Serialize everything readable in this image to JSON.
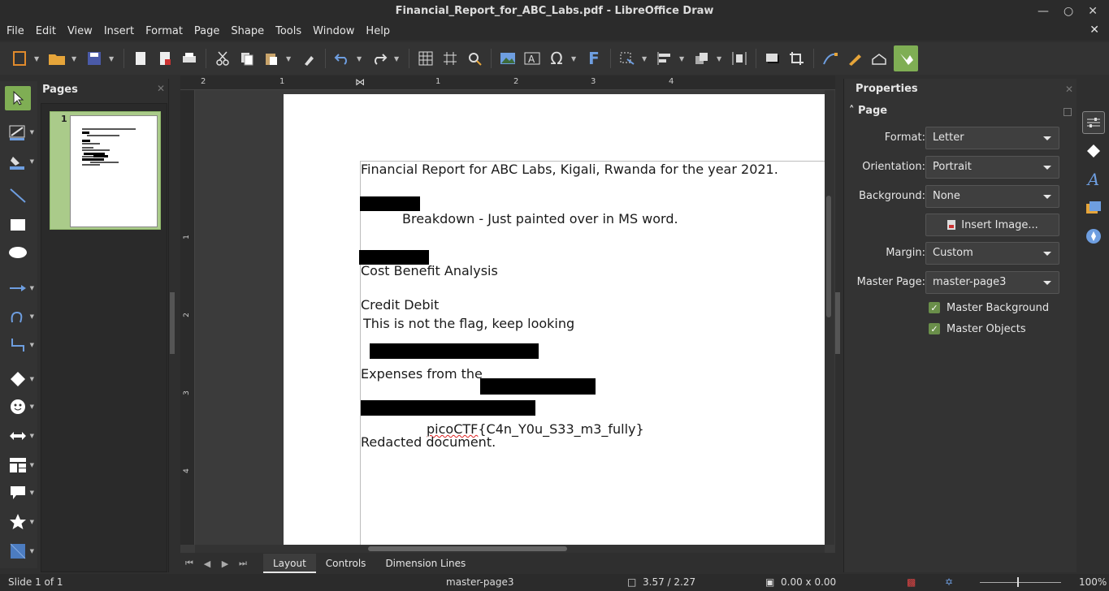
{
  "window": {
    "title": "Financial_Report_for_ABC_Labs.pdf - LibreOffice Draw"
  },
  "menu": [
    "File",
    "Edit",
    "View",
    "Insert",
    "Format",
    "Page",
    "Shape",
    "Tools",
    "Window",
    "Help"
  ],
  "pages_panel": {
    "title": "Pages",
    "page_number": "1"
  },
  "ruler": {
    "h_labels": [
      "2",
      "1",
      "1",
      "2",
      "3",
      "4"
    ],
    "v_labels": [
      "1",
      "2",
      "3",
      "4"
    ]
  },
  "document": {
    "line1": "Financial Report for ABC Labs, Kigali, Rwanda for the year 2021.",
    "line2": "Breakdown - Just painted over in MS word.",
    "line3": "Cost Benefit Analysis",
    "line4": "Credit Debit",
    "line5": "This is not the flag, keep looking",
    "line6": "Expenses from the",
    "flag_prefix": "picoCTF",
    "flag_rest": "{C4n_Y0u_S33_m3_fully}",
    "line8": "Redacted document."
  },
  "tabs": [
    "Layout",
    "Controls",
    "Dimension Lines"
  ],
  "properties": {
    "title": "Properties",
    "section": "Page",
    "format_label": "Format:",
    "format_value": "Letter",
    "orientation_label": "Orientation:",
    "orientation_value": "Portrait",
    "background_label": "Background:",
    "background_value": "None",
    "insert_image": "Insert Image...",
    "margin_label": "Margin:",
    "margin_value": "Custom",
    "master_page_label": "Master Page:",
    "master_page_value": "master-page3",
    "master_background": "Master Background",
    "master_objects": "Master Objects"
  },
  "status": {
    "slide": "Slide 1 of 1",
    "master": "master-page3",
    "position": "3.57 / 2.27",
    "size": "0.00 x 0.00",
    "zoom": "100%"
  },
  "colors": {
    "accent": "#7fae54",
    "background": "#2f2f2f",
    "page": "#ffffff"
  }
}
